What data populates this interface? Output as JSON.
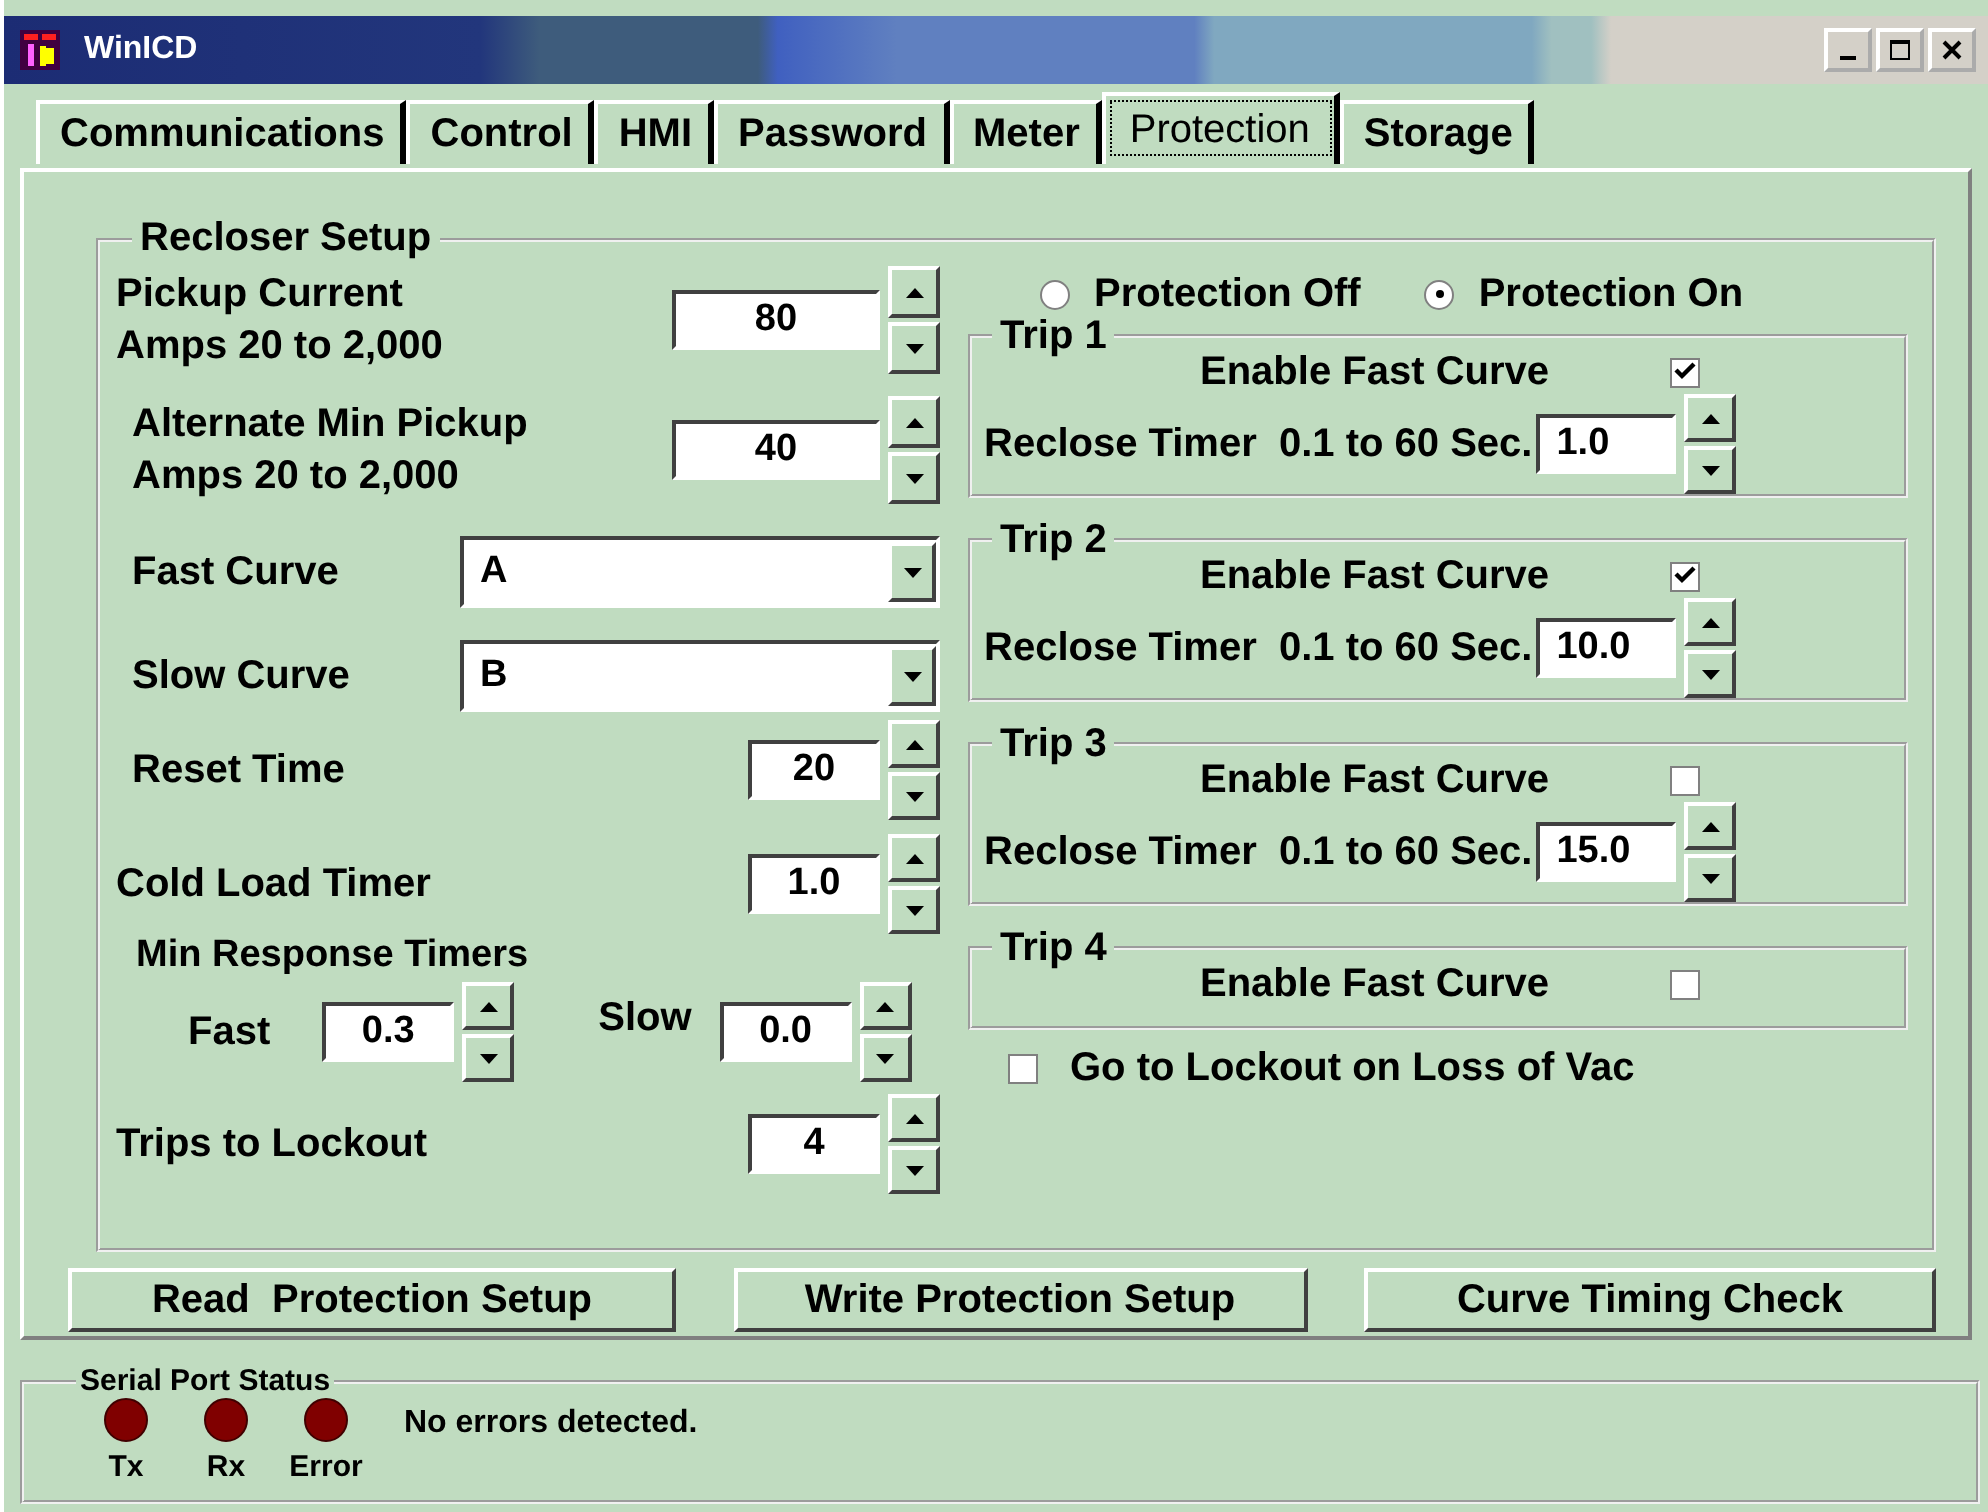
{
  "window": {
    "title": "WinICD"
  },
  "tabs": [
    {
      "label": "Communications",
      "selected": false
    },
    {
      "label": "Control",
      "selected": false
    },
    {
      "label": "HMI",
      "selected": false
    },
    {
      "label": "Password",
      "selected": false
    },
    {
      "label": "Meter",
      "selected": false
    },
    {
      "label": "Protection",
      "selected": true
    },
    {
      "label": "Storage",
      "selected": false
    }
  ],
  "recloser_setup": {
    "title": "Recloser Setup",
    "pickup_current": {
      "label": "Pickup Current",
      "range": "Amps 20 to 2,000",
      "value": "80"
    },
    "alternate_min_pickup": {
      "label": "Alternate Min Pickup",
      "range": "Amps 20 to 2,000",
      "value": "40"
    },
    "fast_curve": {
      "label": "Fast Curve",
      "value": "A"
    },
    "slow_curve": {
      "label": "Slow Curve",
      "value": "B"
    },
    "reset_time": {
      "label": "Reset Time",
      "value": "20"
    },
    "cold_load_timer": {
      "label": "Cold Load Timer",
      "value": "1.0"
    },
    "min_response_timers": {
      "title": "Min Response Timers",
      "fast": {
        "label": "Fast",
        "value": "0.3"
      },
      "slow": {
        "label": "Slow",
        "value": "0.0"
      }
    },
    "trips_to_lockout": {
      "label": "Trips to Lockout",
      "value": "4"
    },
    "protection_mode": [
      {
        "label": "Protection Off",
        "selected": false
      },
      {
        "label": "Protection On",
        "selected": true
      }
    ],
    "trips": [
      {
        "title": "Trip 1",
        "enable_label": "Enable Fast Curve",
        "checked": true,
        "timer_label": "Reclose Timer  0.1 to 60 Sec.",
        "timer_value": "1.0"
      },
      {
        "title": "Trip 2",
        "enable_label": "Enable Fast Curve",
        "checked": true,
        "timer_label": "Reclose Timer  0.1 to 60 Sec.",
        "timer_value": "10.0"
      },
      {
        "title": "Trip 3",
        "enable_label": "Enable Fast Curve",
        "checked": false,
        "timer_label": "Reclose Timer  0.1 to 60 Sec.",
        "timer_value": "15.0"
      },
      {
        "title": "Trip 4",
        "enable_label": "Enable Fast Curve",
        "checked": false
      }
    ],
    "lockout_on_loss_of_vac": {
      "label": "Go to Lockout on Loss of Vac",
      "checked": false
    }
  },
  "buttons": [
    "Read  Protection Setup",
    "Write Protection Setup",
    "Curve Timing Check"
  ],
  "serial_port_status": {
    "title": "Serial Port Status",
    "indicators": [
      "Tx",
      "Rx",
      "Error"
    ],
    "message": "No errors detected."
  }
}
